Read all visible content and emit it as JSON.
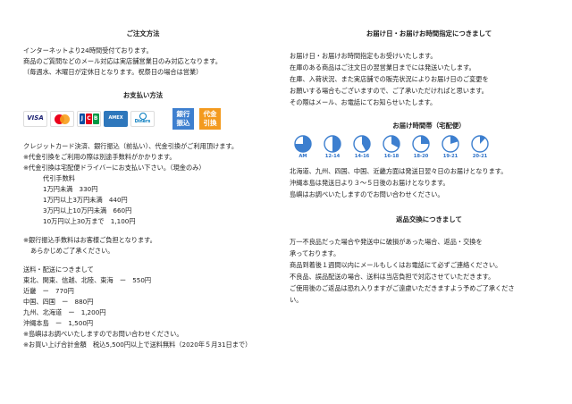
{
  "colors": {
    "text": "#222222",
    "accent": "#3d7fcf",
    "cod": "#f39a1e"
  },
  "order": {
    "heading": "ご注文方法",
    "lines": [
      "インターネットより24時間受付ております。",
      "商品のご質問などのメール対応は実店舗営業日のみ対応となります。",
      "（毎週水、木曜日が定休日となります。祝祭日の場合は営業）"
    ]
  },
  "payment": {
    "heading": "お支払い方法",
    "cards": [
      {
        "name": "VISA",
        "icon": "visa-logo"
      },
      {
        "name": "Mastercard",
        "icon": "mastercard-logo"
      },
      {
        "name": "JCB",
        "icon": "jcb-logo"
      },
      {
        "name": "AMERICAN EXPRESS",
        "icon": "amex-logo"
      },
      {
        "name": "Diners Club",
        "icon": "diners-logo"
      }
    ],
    "bank_badge": [
      "銀行",
      "振込"
    ],
    "cod_badge": [
      "代金",
      "引換"
    ],
    "lines": [
      "クレジットカード決済、銀行振込（前払い）、代金引換がご利用頂けます。",
      "※代金引換をご利用の際は別途手数料がかかります。",
      "※代金引換は宅配便ドライバーにお支払い下さい。（現金のみ）"
    ],
    "fee_title": "代引手数料",
    "fees": [
      "1万円未満　330円",
      "1万円以上3万円未満　440円",
      "3万円以上10万円未満　660円",
      "10万円以上30万まで　1,100円"
    ],
    "bank_note": [
      "※銀行振込手数料はお客様ご負担となります。",
      "あらかじめご了承ください。"
    ]
  },
  "shipping": {
    "title": "送料・配送につきまして",
    "rows": [
      "東北、関東、信越、北陸、東海　ー　550円",
      "近畿　ー　770円",
      "中国、四国　ー　880円",
      "九州、北海道　ー　1,200円",
      "沖縄本島　ー　1,500円"
    ],
    "notes": [
      "※島嶼はお調べいたしますのでお問い合わせください。",
      "※お買い上げ合計金額　税込5,500円以上で送料無料（2020年５月31日まで）"
    ]
  },
  "delivery_date": {
    "heading": "お届け日・お届けお時間指定につきまして",
    "lines": [
      "お届け日・お届けお時間指定もお受けいたします。",
      "在庫のある商品はご注文日の翌営業日までには発送いたします。",
      "在庫、入荷状況、また実店舗での販売状況によりお届け日のご変更を",
      "お願いする場合もございますので、ご了承いただければと思います。",
      "その際はメール、お電話にてお知らせいたします。"
    ]
  },
  "time_slots": {
    "heading": "お届け時間帯（宅配便）",
    "slots": [
      {
        "label": "AM",
        "fraction": 0.75
      },
      {
        "label": "12-14",
        "fraction": 0.5
      },
      {
        "label": "14-16",
        "fraction": 0.42
      },
      {
        "label": "16-18",
        "fraction": 0.33
      },
      {
        "label": "18-20",
        "fraction": 0.25
      },
      {
        "label": "19-21",
        "fraction": 0.2
      },
      {
        "label": "20-21",
        "fraction": 0.12
      }
    ],
    "lines": [
      "北海道、九州、四国、中国、近畿方面は発送日翌々日のお届けとなります。",
      "沖縄本島は発送日より３〜５日後のお届けとなります。",
      "島嶼はお調べいたしますのでお問い合わせください。"
    ]
  },
  "returns": {
    "heading": "返品交換につきまして",
    "lines": [
      "万一不良品だった場合や発送中に破損があった場合、返品・交換を",
      "承っております。",
      "商品到着後１週間以内にメールもしくはお電話にて必ずご連絡ください。",
      "不良品、誤品配送の場合、送料は当店負担で対応させていただきます。",
      "ご使用後のご返品は恐れ入りますがご遠慮いただきますよう予めご了承くださ",
      "い。"
    ]
  }
}
